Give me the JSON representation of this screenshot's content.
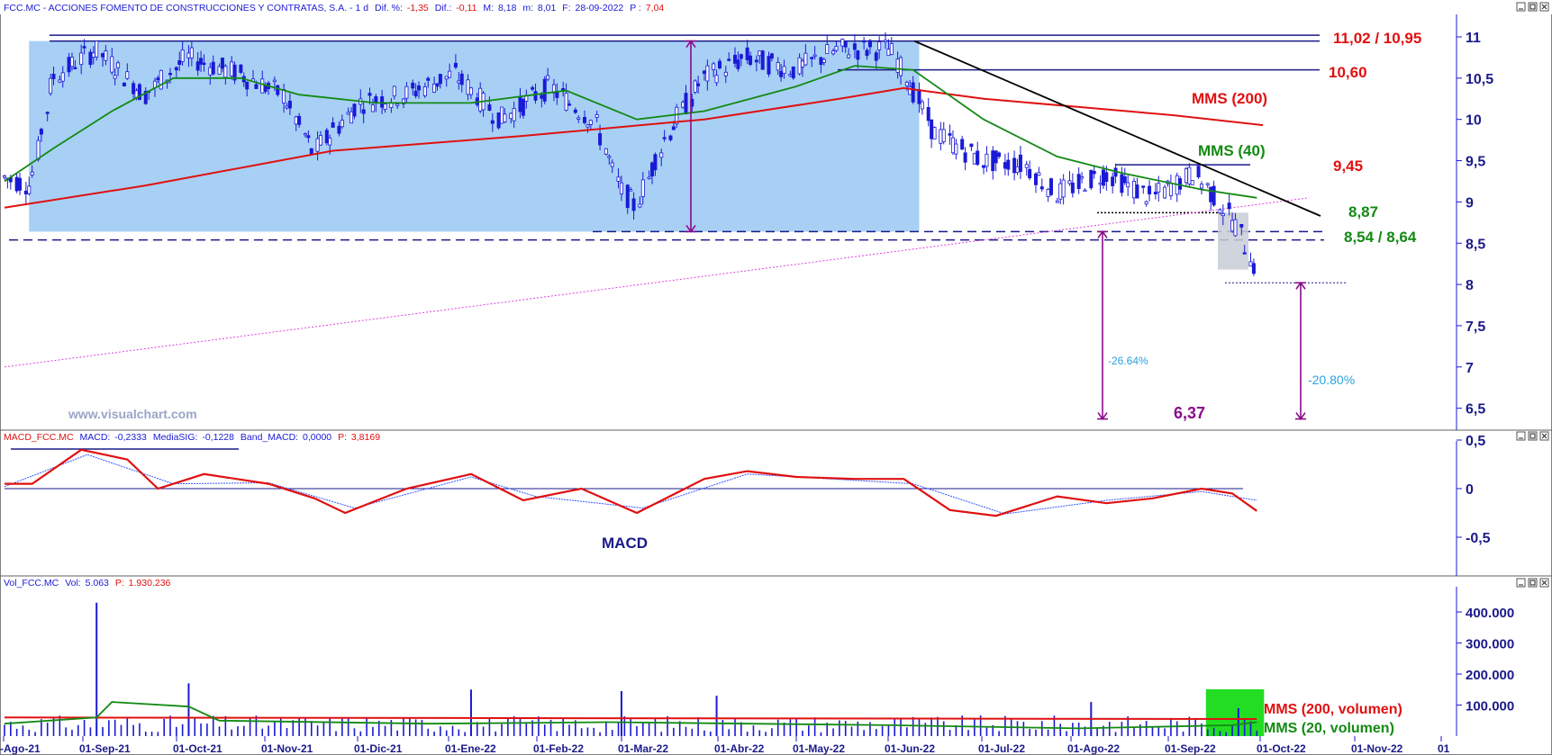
{
  "price_panel": {
    "info_title": "FCC.MC - ACCIONES FOMENTO DE CONSTRUCCIONES Y CONTRATAS, S.A. -  1 d",
    "info_dif_pct_label": "Dif. %:",
    "info_dif_pct": "-1,35",
    "info_dif_label": "Dif.:",
    "info_dif": "-0,11",
    "info_max_label": "M:",
    "info_max": "8,18",
    "info_min_label": "m:",
    "info_min": "8,01",
    "info_date_label": "F:",
    "info_date": "28-09-2022",
    "info_price_label": "P :",
    "info_price": "7,04",
    "watermark": "www.visualchart.com",
    "y_ticks": [
      "11",
      "10,5",
      "10",
      "9,5",
      "9",
      "8,5",
      "8",
      "7,5",
      "7",
      "6,5"
    ],
    "annotations": {
      "resistance_top": "11,02 / 10,95",
      "resistance_mid": "10,60",
      "mms200": "MMS (200)",
      "level_945": "9,45",
      "mms40": "MMS (40)",
      "level_887": "8,87",
      "level_854": "8,54 / 8,64",
      "pct_left": "-26.64%",
      "pct_right": "-20.80%",
      "target": "6,37"
    }
  },
  "macd_panel": {
    "info_name": "MACD_FCC.MC",
    "info_macd_label": "MACD:",
    "info_macd": "-0,2333",
    "info_sig_label": "MediaSIG:",
    "info_sig": "-0,1228",
    "info_band_label": "Band_MACD:",
    "info_band": "0,0000",
    "info_p_label": "P:",
    "info_p": "3,8169",
    "label": "MACD",
    "y_ticks": [
      "0,5",
      "0",
      "-0,5"
    ]
  },
  "volume_panel": {
    "info_name": "Vol_FCC.MC",
    "info_vol_label": "Vol:",
    "info_vol": "5.063",
    "info_p_label": "P:",
    "info_p": "1.930.236",
    "y_ticks": [
      "400.000",
      "300.000",
      "200.000",
      "100.000"
    ],
    "legend_mms200": "MMS (200, volumen)",
    "legend_mms20": "MMS (20, volumen)"
  },
  "x_axis": {
    "labels": [
      "-Ago-21",
      "01-Sep-21",
      "01-Oct-21",
      "01-Nov-21",
      "01-Dic-21",
      "01-Ene-22",
      "01-Feb-22",
      "01-Mar-22",
      "01-Abr-22",
      "01-May-22",
      "01-Jun-22",
      "01-Jul-22",
      "01-Ago-22",
      "01-Sep-22",
      "01-Oct-22",
      "01-Nov-22",
      "01"
    ]
  },
  "colors": {
    "price": "#1a1ad6",
    "mms200": "#e01010",
    "mms40": "#138a13",
    "range_box": "#a8d0f5",
    "trendline": "#000000",
    "support_trend": "#e040e0",
    "arrows": "#8a0a8a",
    "pct_text": "#2aa0e0",
    "macd_signal": "#3355ff",
    "volume_highlight": "#22dd22"
  },
  "chart_data": [
    {
      "type": "candlestick",
      "x_range": [
        "2021-08-16",
        "2022-11-30"
      ],
      "ylim": [
        6.25,
        11.15
      ],
      "series": [
        {
          "name": "MMS (200)",
          "points": [
            [
              "2021-08-16",
              8.93
            ],
            [
              "2021-10-01",
              9.2
            ],
            [
              "2021-12-01",
              9.62
            ],
            [
              "2022-02-01",
              9.8
            ],
            [
              "2022-04-01",
              10.0
            ],
            [
              "2022-05-15",
              10.25
            ],
            [
              "2022-06-05",
              10.38
            ],
            [
              "2022-07-01",
              10.25
            ],
            [
              "2022-08-01",
              10.15
            ],
            [
              "2022-09-01",
              10.05
            ],
            [
              "2022-09-30",
              9.93
            ]
          ]
        },
        {
          "name": "MMS (40)",
          "points": [
            [
              "2021-08-16",
              9.25
            ],
            [
              "2021-09-01",
              9.65
            ],
            [
              "2021-09-20",
              10.1
            ],
            [
              "2021-10-10",
              10.5
            ],
            [
              "2021-11-01",
              10.5
            ],
            [
              "2021-11-20",
              10.3
            ],
            [
              "2021-12-15",
              10.2
            ],
            [
              "2022-01-15",
              10.2
            ],
            [
              "2022-02-15",
              10.35
            ],
            [
              "2022-03-10",
              10.0
            ],
            [
              "2022-04-01",
              10.1
            ],
            [
              "2022-05-01",
              10.4
            ],
            [
              "2022-05-20",
              10.65
            ],
            [
              "2022-06-08",
              10.6
            ],
            [
              "2022-07-01",
              10.0
            ],
            [
              "2022-07-25",
              9.55
            ],
            [
              "2022-08-15",
              9.35
            ],
            [
              "2022-09-10",
              9.15
            ],
            [
              "2022-09-28",
              9.05
            ]
          ]
        },
        {
          "name": "price",
          "points": [
            [
              "2021-08-16",
              9.3
            ],
            [
              "2021-08-25",
              9.2
            ],
            [
              "2021-09-01",
              10.5
            ],
            [
              "2021-09-15",
              10.85
            ],
            [
              "2021-10-01",
              10.3
            ],
            [
              "2021-10-15",
              10.75
            ],
            [
              "2021-11-01",
              10.55
            ],
            [
              "2021-11-15",
              10.3
            ],
            [
              "2021-11-25",
              9.6
            ],
            [
              "2021-12-10",
              10.2
            ],
            [
              "2021-12-25",
              10.3
            ],
            [
              "2022-01-10",
              10.55
            ],
            [
              "2022-01-25",
              10.0
            ],
            [
              "2022-02-10",
              10.4
            ],
            [
              "2022-02-25",
              9.95
            ],
            [
              "2022-03-05",
              9.15
            ],
            [
              "2022-03-10",
              8.95
            ],
            [
              "2022-03-20",
              9.8
            ],
            [
              "2022-04-01",
              10.5
            ],
            [
              "2022-04-15",
              10.75
            ],
            [
              "2022-05-01",
              10.6
            ],
            [
              "2022-05-15",
              10.85
            ],
            [
              "2022-06-01",
              10.85
            ],
            [
              "2022-06-08",
              10.4
            ],
            [
              "2022-06-15",
              9.85
            ],
            [
              "2022-07-01",
              9.5
            ],
            [
              "2022-07-15",
              9.45
            ],
            [
              "2022-07-25",
              9.1
            ],
            [
              "2022-08-10",
              9.35
            ],
            [
              "2022-08-25",
              9.05
            ],
            [
              "2022-09-08",
              9.35
            ],
            [
              "2022-09-15",
              9.05
            ],
            [
              "2022-09-22",
              8.7
            ],
            [
              "2022-09-28",
              8.18
            ]
          ]
        }
      ],
      "horizontal_levels": [
        11.02,
        10.95,
        10.6,
        9.45,
        8.87,
        8.64,
        8.54,
        8.02
      ],
      "range_box": {
        "x": [
          "2021-08-24",
          "2022-06-10"
        ],
        "y": [
          8.64,
          10.95
        ]
      },
      "downtrend_line": [
        [
          "2022-06-05",
          10.95
        ],
        [
          "2022-10-15",
          8.83
        ]
      ],
      "support_trendline": [
        [
          "2021-08-16",
          7.0
        ],
        [
          "2022-10-15",
          9.05
        ]
      ],
      "measured_moves": [
        {
          "x": "2022-03-20",
          "y": [
            8.64,
            10.95
          ]
        },
        {
          "x": "2022-08-01",
          "y": [
            6.37,
            8.64
          ],
          "label": "-26.64%"
        },
        {
          "x": "2022-10-05",
          "y": [
            6.37,
            8.02
          ],
          "label": "-20.80%"
        }
      ]
    },
    {
      "type": "line",
      "name": "MACD",
      "ylim": [
        -0.9,
        0.55
      ],
      "series": [
        {
          "name": "MACD",
          "points": [
            [
              "2021-08-16",
              0.05
            ],
            [
              "2021-08-25",
              0.05
            ],
            [
              "2021-09-10",
              0.4
            ],
            [
              "2021-09-25",
              0.3
            ],
            [
              "2021-10-05",
              0.0
            ],
            [
              "2021-10-20",
              0.15
            ],
            [
              "2021-11-10",
              0.05
            ],
            [
              "2021-11-25",
              -0.1
            ],
            [
              "2021-12-05",
              -0.25
            ],
            [
              "2021-12-25",
              0.0
            ],
            [
              "2022-01-15",
              0.15
            ],
            [
              "2022-02-01",
              -0.12
            ],
            [
              "2022-02-20",
              0.0
            ],
            [
              "2022-03-10",
              -0.25
            ],
            [
              "2022-04-01",
              0.1
            ],
            [
              "2022-04-15",
              0.18
            ],
            [
              "2022-05-01",
              0.12
            ],
            [
              "2022-05-20",
              0.1
            ],
            [
              "2022-06-05",
              0.1
            ],
            [
              "2022-06-20",
              -0.22
            ],
            [
              "2022-07-05",
              -0.28
            ],
            [
              "2022-07-25",
              -0.08
            ],
            [
              "2022-08-10",
              -0.15
            ],
            [
              "2022-08-25",
              -0.1
            ],
            [
              "2022-09-10",
              0.0
            ],
            [
              "2022-09-20",
              -0.05
            ],
            [
              "2022-09-28",
              -0.23
            ]
          ]
        },
        {
          "name": "MediaSIG",
          "points": [
            [
              "2021-08-16",
              0.02
            ],
            [
              "2021-09-12",
              0.35
            ],
            [
              "2021-10-10",
              0.05
            ],
            [
              "2021-11-10",
              0.06
            ],
            [
              "2021-12-08",
              -0.2
            ],
            [
              "2022-01-15",
              0.12
            ],
            [
              "2022-02-05",
              -0.08
            ],
            [
              "2022-03-12",
              -0.2
            ],
            [
              "2022-04-15",
              0.15
            ],
            [
              "2022-06-08",
              0.05
            ],
            [
              "2022-07-08",
              -0.26
            ],
            [
              "2022-08-10",
              -0.12
            ],
            [
              "2022-09-10",
              -0.03
            ],
            [
              "2022-09-28",
              -0.12
            ]
          ]
        }
      ],
      "zero_line": 0
    },
    {
      "type": "bar",
      "name": "Volumen",
      "ylim": [
        0,
        450000
      ],
      "x_range": [
        "2021-08-16",
        "2022-09-28"
      ],
      "highlight_x": [
        "2022-09-12",
        "2022-09-28"
      ],
      "spikes": [
        [
          "2021-09-15",
          430000
        ],
        [
          "2021-10-15",
          170000
        ],
        [
          "2022-01-15",
          150000
        ],
        [
          "2022-03-05",
          145000
        ],
        [
          "2022-04-05",
          130000
        ],
        [
          "2022-08-05",
          110000
        ],
        [
          "2022-09-22",
          90000
        ]
      ],
      "series": [
        {
          "name": "MMS (200, volumen)",
          "points": [
            [
              "2021-08-16",
              60000
            ],
            [
              "2022-09-28",
              55000
            ]
          ]
        },
        {
          "name": "MMS (20, volumen)",
          "points": [
            [
              "2021-08-16",
              40000
            ],
            [
              "2021-09-15",
              60000
            ],
            [
              "2021-09-20",
              110000
            ],
            [
              "2021-10-15",
              95000
            ],
            [
              "2021-10-25",
              50000
            ],
            [
              "2022-01-01",
              40000
            ],
            [
              "2022-03-01",
              45000
            ],
            [
              "2022-06-01",
              35000
            ],
            [
              "2022-08-01",
              25000
            ],
            [
              "2022-09-20",
              35000
            ],
            [
              "2022-09-28",
              45000
            ]
          ]
        }
      ]
    }
  ]
}
